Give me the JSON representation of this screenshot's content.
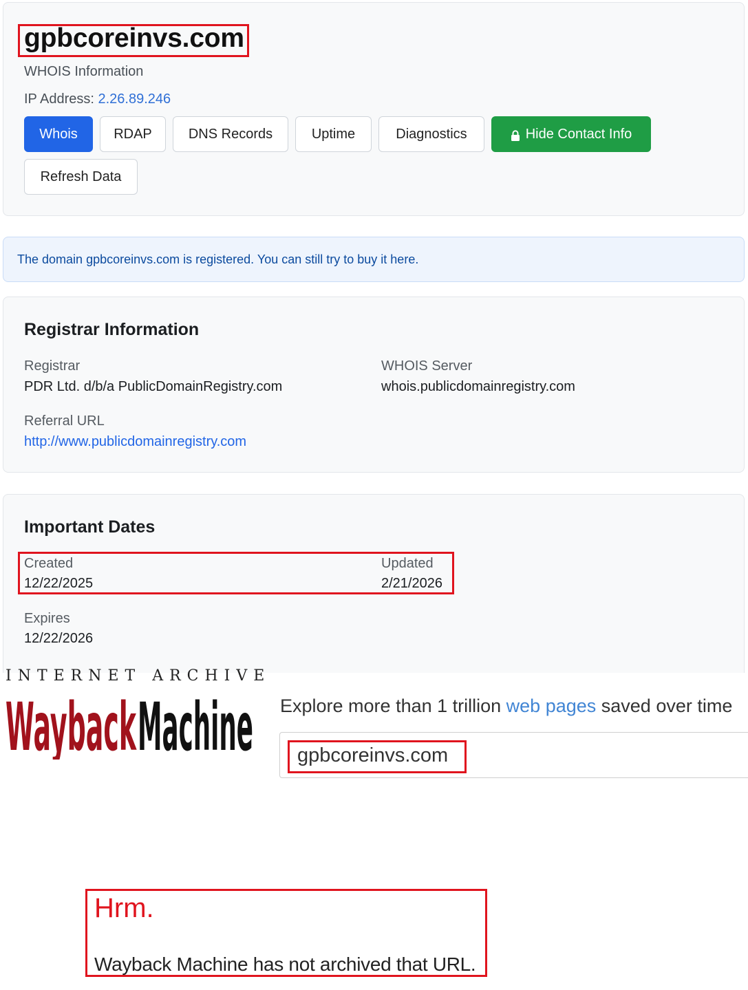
{
  "header": {
    "domain": "gpbcoreinvs.com",
    "subtitle": "WHOIS Information",
    "ip_label": "IP Address:",
    "ip_value": "2.26.89.246",
    "buttons": {
      "whois": "Whois",
      "rdap": "RDAP",
      "dns": "DNS Records",
      "uptime": "Uptime",
      "diagnostics": "Diagnostics",
      "hide_contact": "Hide Contact Info",
      "refresh": "Refresh Data"
    },
    "colors": {
      "primary": "#2165e6",
      "success": "#1f9d45"
    }
  },
  "alert": {
    "prefix": "The domain ",
    "domain": "gpbcoreinvs.com",
    "middle": " is registered. You can still try to buy it ",
    "link": "here",
    "suffix": "."
  },
  "registrar": {
    "title": "Registrar Information",
    "registrar_label": "Registrar",
    "registrar_value": "PDR Ltd. d/b/a PublicDomainRegistry.com",
    "whois_server_label": "WHOIS Server",
    "whois_server_value": "whois.publicdomainregistry.com",
    "referral_label": "Referral URL",
    "referral_value": "http://www.publicdomainregistry.com"
  },
  "dates": {
    "title": "Important Dates",
    "created_label": "Created",
    "created_value": "12/22/2025",
    "updated_label": "Updated",
    "updated_value": "2/21/2026",
    "expires_label": "Expires",
    "expires_value": "12/22/2026"
  },
  "wayback": {
    "ia_wordmark": "INTERNET ARCHIVE",
    "logo_text": "WaybackMachine",
    "tagline_pre": "Explore more than 1 trillion ",
    "tagline_link": "web pages",
    "tagline_post": " saved over time",
    "search_value": "gpbcoreinvs.com",
    "hrm": "Hrm.",
    "message": "Wayback Machine has not archived that URL."
  },
  "annotation_color": "#e0141e"
}
